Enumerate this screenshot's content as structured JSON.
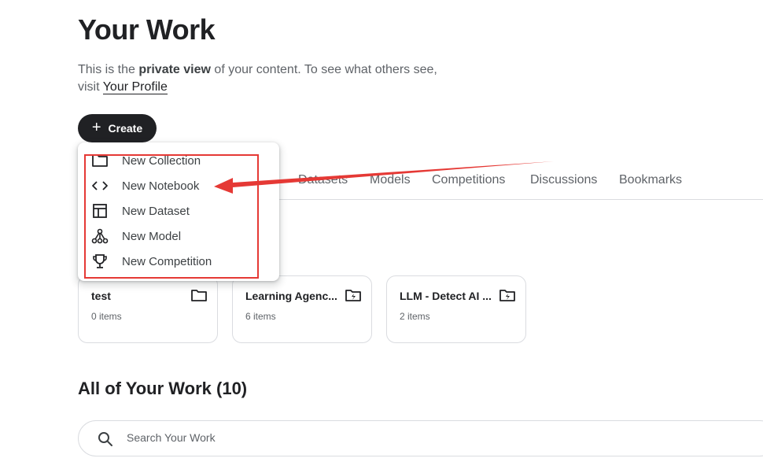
{
  "header": {
    "title": "Your Work",
    "subtitle_prefix": "This is the ",
    "subtitle_bold": "private view",
    "subtitle_middle": " of your content. To see what others see, visit ",
    "profile_link": "Your Profile"
  },
  "create_button": {
    "label": "Create",
    "icon": "plus-icon"
  },
  "create_menu": {
    "items": [
      {
        "label": "New Collection",
        "icon": "folder-icon"
      },
      {
        "label": "New Notebook",
        "icon": "code-icon"
      },
      {
        "label": "New Dataset",
        "icon": "table-icon"
      },
      {
        "label": "New Model",
        "icon": "model-graph-icon"
      },
      {
        "label": "New Competition",
        "icon": "trophy-icon"
      }
    ]
  },
  "tabs": [
    {
      "label": "Datasets"
    },
    {
      "label": "Models"
    },
    {
      "label": "Competitions"
    },
    {
      "label": "Discussions"
    },
    {
      "label": "Bookmarks"
    }
  ],
  "collections": [
    {
      "title": "test",
      "count": "0 items",
      "icon": "folder-icon"
    },
    {
      "title": "Learning Agency Lab",
      "display_title": "Learning Agenc...",
      "count": "6 items",
      "icon": "folder-bolt-icon"
    },
    {
      "title": "LLM - Detect AI Generated Text",
      "display_title": "LLM - Detect AI ...",
      "count": "2 items",
      "icon": "folder-bolt-icon"
    }
  ],
  "all_work": {
    "title": "All of Your Work (10)"
  },
  "search": {
    "placeholder": "Search Your Work",
    "value": ""
  },
  "annotation": {
    "color": "#e53935"
  }
}
